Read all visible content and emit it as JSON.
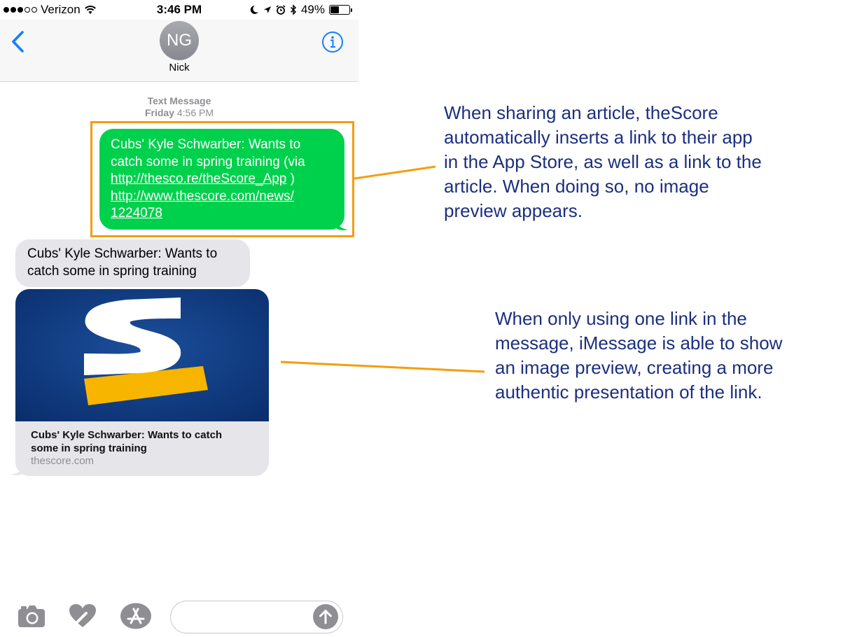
{
  "status_bar": {
    "carrier": "Verizon",
    "time": "3:46 PM",
    "battery_percent": "49%",
    "battery_level": 0.49
  },
  "nav": {
    "avatar_initials": "NG",
    "contact_name": "Nick"
  },
  "conversation": {
    "timestamp_label": "Text Message",
    "timestamp_day": "Friday",
    "timestamp_time": "4:56 PM",
    "sent_message": {
      "text_line1": "Cubs' Kyle Schwarber: Wants to",
      "text_line2": "catch some in spring training (via",
      "link1": "http://thesco.re/theScore_App",
      "link1_suffix": " )",
      "link2_line1": "http://www.thescore.com/news/",
      "link2_line2": "1224078"
    },
    "received_message": {
      "text_line1": "Cubs' Kyle Schwarber: Wants to",
      "text_line2": "catch some in spring training"
    },
    "link_preview": {
      "title_line1": "Cubs' Kyle Schwarber: Wants to catch",
      "title_line2": "some in spring training",
      "domain": "thescore.com"
    }
  },
  "icons": {
    "back": "chevron-left-icon",
    "info": "info-icon",
    "camera": "camera-icon",
    "digital_touch": "heart-icon",
    "app_store": "app-store-icon",
    "send": "arrow-up-icon"
  },
  "annotations": {
    "top_lines": [
      "When sharing an article, theScore",
      "automatically inserts a link to their app",
      "in the App Store, as well as a link to the",
      "article. When doing so, no image",
      "preview appears."
    ],
    "bottom_lines": [
      "When only using one link in the",
      "message, iMessage is able to show",
      "an image preview, creating a more",
      "authentic presentation of the link."
    ]
  },
  "colors": {
    "sent_bubble": "#00d14d",
    "received_bubble": "#e5e5ea",
    "highlight": "#f59d0e",
    "annotation_text": "#1c2f7f",
    "ios_blue": "#157efb",
    "score_blue": "#0b3a85",
    "score_yellow": "#f7b500"
  }
}
